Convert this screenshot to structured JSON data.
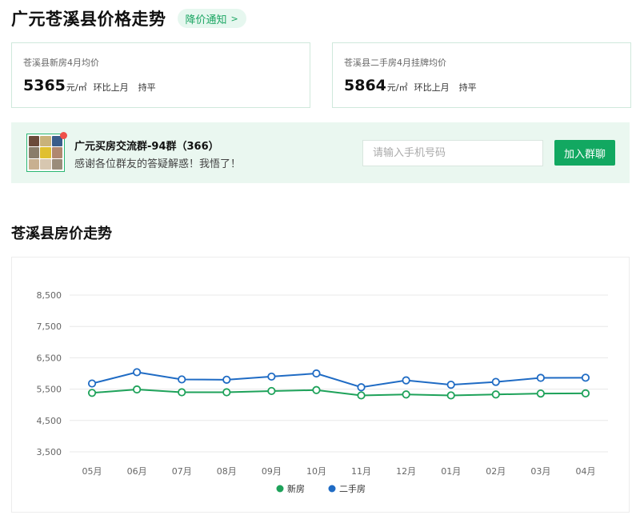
{
  "header": {
    "title": "广元苍溪县价格走势",
    "notify_label": "降价通知",
    "notify_icon": "chevron-right-icon"
  },
  "cards": [
    {
      "label": "苍溪县新房4月均价",
      "value": "5365",
      "unit": "元/㎡",
      "compare_label": "环比上月",
      "compare_value": "持平"
    },
    {
      "label": "苍溪县二手房4月挂牌均价",
      "value": "5864",
      "unit": "元/㎡",
      "compare_label": "环比上月",
      "compare_value": "持平"
    }
  ],
  "group": {
    "name": "广元买房交流群-94群（366）",
    "desc": "感谢各位群友的答疑解惑！我悟了！",
    "phone_placeholder": "请输入手机号码",
    "join_label": "加入群聊",
    "avatar_colors": [
      "#6b4a3a",
      "#c9b27a",
      "#3a5d8a",
      "#8a7d6b",
      "#e0c030",
      "#b08870",
      "#c8b090",
      "#d7c7b0",
      "#9a8c7a"
    ]
  },
  "section_title": "苍溪县房价走势",
  "chart_data": {
    "type": "line",
    "categories": [
      "05月",
      "06月",
      "07月",
      "08月",
      "09月",
      "10月",
      "11月",
      "12月",
      "01月",
      "02月",
      "03月",
      "04月"
    ],
    "series": [
      {
        "name": "新房",
        "color": "#1ea25a",
        "values": [
          5380,
          5490,
          5400,
          5400,
          5440,
          5470,
          5300,
          5330,
          5300,
          5330,
          5360,
          5365
        ]
      },
      {
        "name": "二手房",
        "color": "#1f6bc4",
        "values": [
          5680,
          6040,
          5810,
          5800,
          5900,
          6000,
          5560,
          5780,
          5640,
          5730,
          5860,
          5864
        ]
      }
    ],
    "y_ticks": [
      "8,500",
      "7,500",
      "6,500",
      "5,500",
      "4,500",
      "3,500"
    ],
    "ylim": [
      3500,
      8500
    ],
    "grid": true,
    "legend_position": "bottom"
  }
}
